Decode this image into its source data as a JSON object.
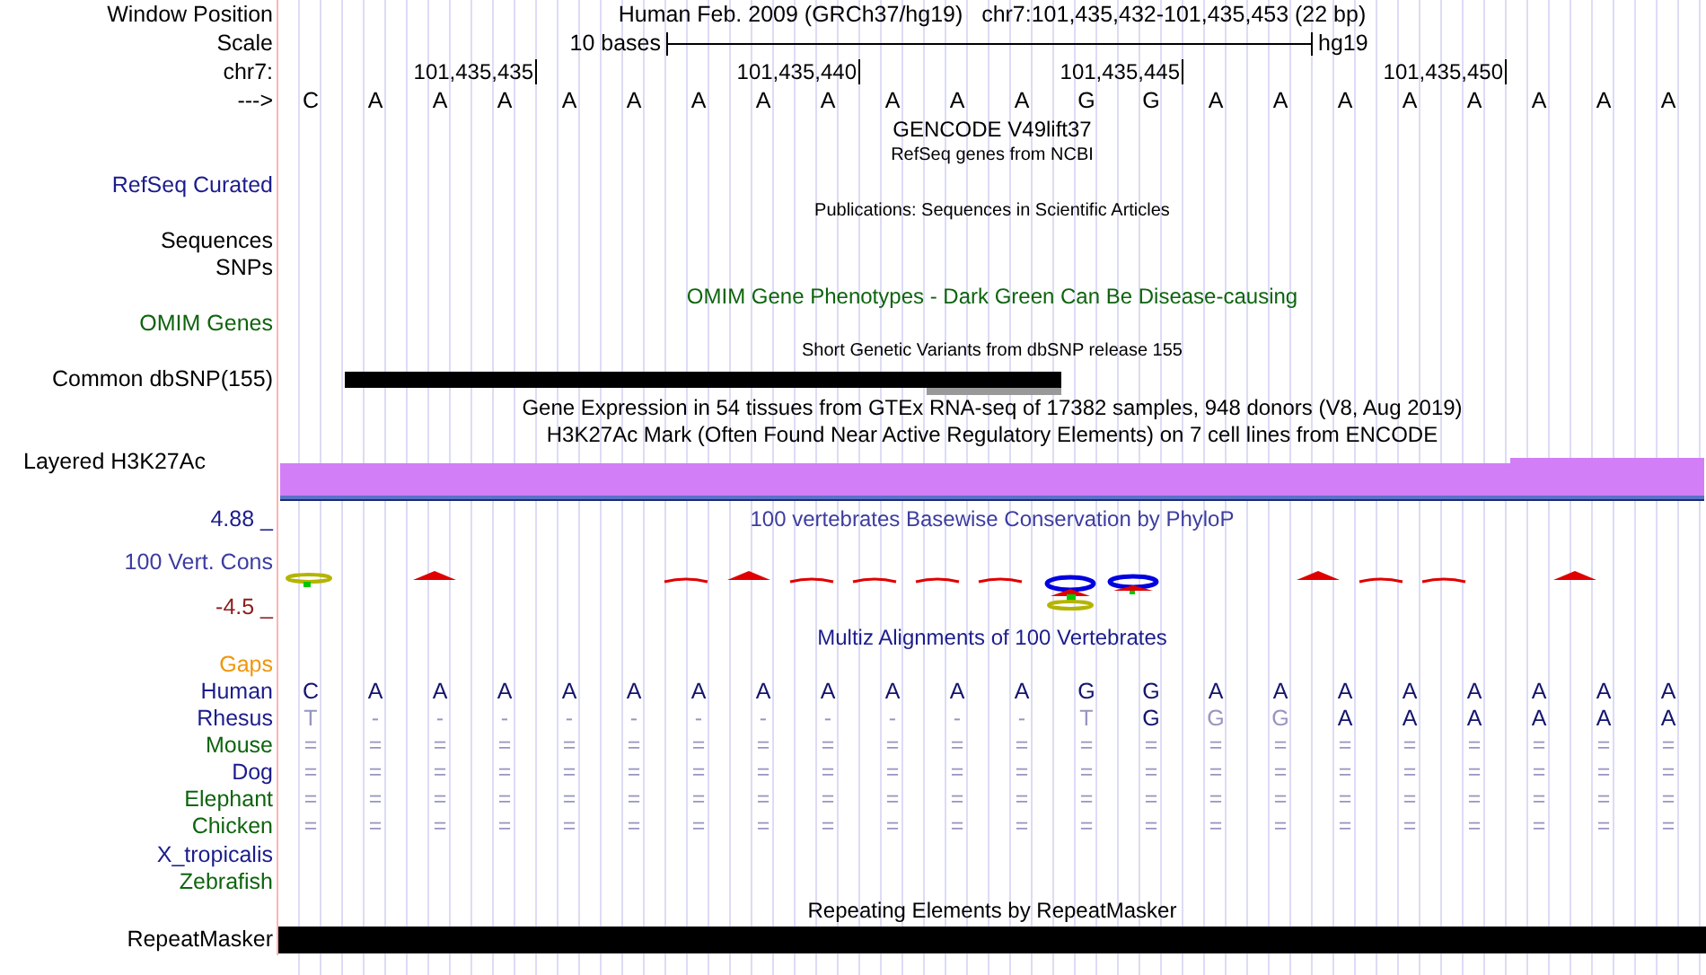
{
  "header": {
    "label": "Window Position",
    "title": "Human Feb. 2009 (GRCh37/hg19)   chr7:101,435,432-101,435,453 (22 bp)"
  },
  "scale": {
    "label": "Scale",
    "text": "10 bases",
    "assembly": "hg19"
  },
  "ruler": {
    "label": "chr7:",
    "ticks": [
      "101,435,435",
      "101,435,440",
      "101,435,445",
      "101,435,450"
    ]
  },
  "sequence": {
    "label": "--->",
    "bases": [
      "C",
      "A",
      "A",
      "A",
      "A",
      "A",
      "A",
      "A",
      "A",
      "A",
      "A",
      "A",
      "G",
      "G",
      "A",
      "A",
      "A",
      "A",
      "A",
      "A",
      "A",
      "A"
    ]
  },
  "tracks": [
    {
      "kind": "title",
      "title": "GENCODE V49lift37"
    },
    {
      "kind": "subtitle",
      "title": "RefSeq genes from NCBI"
    },
    {
      "kind": "label",
      "label": "RefSeq Curated",
      "color": "#1c1c8c"
    },
    {
      "kind": "subtitle",
      "title": "Publications: Sequences in Scientific Articles"
    },
    {
      "kind": "label",
      "label": "Sequences",
      "color": "#000000"
    },
    {
      "kind": "label",
      "label": "SNPs",
      "color": "#000000"
    },
    {
      "kind": "title",
      "title": "OMIM Gene Phenotypes - Dark Green Can Be Disease-causing",
      "color": "#0e640e"
    },
    {
      "kind": "label",
      "label": "OMIM Genes",
      "color": "#0e640e"
    },
    {
      "kind": "subtitle",
      "title": "Short Genetic Variants from dbSNP release 155"
    },
    {
      "kind": "variants",
      "label": "Common dbSNP(155)"
    },
    {
      "kind": "title",
      "title": "Gene Expression in 54 tissues from GTEx RNA-seq of 17382 samples, 948 donors (V8, Aug 2019)"
    },
    {
      "kind": "title",
      "title": "H3K27Ac Mark (Often Found Near Active Regulatory Elements) on 7 cell lines from ENCODE"
    },
    {
      "kind": "signal",
      "label": "Layered H3K27Ac"
    },
    {
      "kind": "conservation",
      "title": "100 vertebrates Basewise Conservation by PhyloP",
      "label": "100 Vert. Cons",
      "max": "4.88 _",
      "min": "-4.5 _"
    },
    {
      "kind": "title",
      "title": "Multiz Alignments of 100 Vertebrates",
      "color": "#1c1c8c"
    },
    {
      "kind": "label",
      "label": "Gaps",
      "color": "#f0960a"
    },
    {
      "kind": "alignment",
      "label": "Human",
      "color": "#1c1c8c",
      "cells": [
        {
          "base": "C",
          "match": true
        },
        {
          "base": "A",
          "match": true
        },
        {
          "base": "A",
          "match": true
        },
        {
          "base": "A",
          "match": true
        },
        {
          "base": "A",
          "match": true
        },
        {
          "base": "A",
          "match": true
        },
        {
          "base": "A",
          "match": true
        },
        {
          "base": "A",
          "match": true
        },
        {
          "base": "A",
          "match": true
        },
        {
          "base": "A",
          "match": true
        },
        {
          "base": "A",
          "match": true
        },
        {
          "base": "A",
          "match": true
        },
        {
          "base": "G",
          "match": true
        },
        {
          "base": "G",
          "match": true
        },
        {
          "base": "A",
          "match": true
        },
        {
          "base": "A",
          "match": true
        },
        {
          "base": "A",
          "match": true
        },
        {
          "base": "A",
          "match": true
        },
        {
          "base": "A",
          "match": true
        },
        {
          "base": "A",
          "match": true
        },
        {
          "base": "A",
          "match": true
        },
        {
          "base": "A",
          "match": true
        }
      ]
    },
    {
      "kind": "alignment",
      "label": "Rhesus",
      "color": "#1c1c8c",
      "cells": [
        {
          "base": "T",
          "match": false
        },
        {
          "base": "-",
          "match": false
        },
        {
          "base": "-",
          "match": false
        },
        {
          "base": "-",
          "match": false
        },
        {
          "base": "-",
          "match": false
        },
        {
          "base": "-",
          "match": false
        },
        {
          "base": "-",
          "match": false
        },
        {
          "base": "-",
          "match": false
        },
        {
          "base": "-",
          "match": false
        },
        {
          "base": "-",
          "match": false
        },
        {
          "base": "-",
          "match": false
        },
        {
          "base": "-",
          "match": false
        },
        {
          "base": "T",
          "match": false
        },
        {
          "base": "G",
          "match": true
        },
        {
          "base": "G",
          "match": false
        },
        {
          "base": "G",
          "match": false
        },
        {
          "base": "A",
          "match": true
        },
        {
          "base": "A",
          "match": true
        },
        {
          "base": "A",
          "match": true
        },
        {
          "base": "A",
          "match": true
        },
        {
          "base": "A",
          "match": true
        },
        {
          "base": "A",
          "match": true
        }
      ]
    },
    {
      "kind": "alignment",
      "label": "Mouse",
      "color": "#0e640e",
      "cells": [
        {
          "base": "=",
          "match": false
        },
        {
          "base": "=",
          "match": false
        },
        {
          "base": "=",
          "match": false
        },
        {
          "base": "=",
          "match": false
        },
        {
          "base": "=",
          "match": false
        },
        {
          "base": "=",
          "match": false
        },
        {
          "base": "=",
          "match": false
        },
        {
          "base": "=",
          "match": false
        },
        {
          "base": "=",
          "match": false
        },
        {
          "base": "=",
          "match": false
        },
        {
          "base": "=",
          "match": false
        },
        {
          "base": "=",
          "match": false
        },
        {
          "base": "=",
          "match": false
        },
        {
          "base": "=",
          "match": false
        },
        {
          "base": "=",
          "match": false
        },
        {
          "base": "=",
          "match": false
        },
        {
          "base": "=",
          "match": false
        },
        {
          "base": "=",
          "match": false
        },
        {
          "base": "=",
          "match": false
        },
        {
          "base": "=",
          "match": false
        },
        {
          "base": "=",
          "match": false
        },
        {
          "base": "=",
          "match": false
        }
      ]
    },
    {
      "kind": "alignment",
      "label": "Dog",
      "color": "#1c1c8c",
      "cells": [
        {
          "base": "=",
          "match": false
        },
        {
          "base": "=",
          "match": false
        },
        {
          "base": "=",
          "match": false
        },
        {
          "base": "=",
          "match": false
        },
        {
          "base": "=",
          "match": false
        },
        {
          "base": "=",
          "match": false
        },
        {
          "base": "=",
          "match": false
        },
        {
          "base": "=",
          "match": false
        },
        {
          "base": "=",
          "match": false
        },
        {
          "base": "=",
          "match": false
        },
        {
          "base": "=",
          "match": false
        },
        {
          "base": "=",
          "match": false
        },
        {
          "base": "=",
          "match": false
        },
        {
          "base": "=",
          "match": false
        },
        {
          "base": "=",
          "match": false
        },
        {
          "base": "=",
          "match": false
        },
        {
          "base": "=",
          "match": false
        },
        {
          "base": "=",
          "match": false
        },
        {
          "base": "=",
          "match": false
        },
        {
          "base": "=",
          "match": false
        },
        {
          "base": "=",
          "match": false
        },
        {
          "base": "=",
          "match": false
        }
      ]
    },
    {
      "kind": "alignment",
      "label": "Elephant",
      "color": "#0e640e",
      "cells": [
        {
          "base": "=",
          "match": false
        },
        {
          "base": "=",
          "match": false
        },
        {
          "base": "=",
          "match": false
        },
        {
          "base": "=",
          "match": false
        },
        {
          "base": "=",
          "match": false
        },
        {
          "base": "=",
          "match": false
        },
        {
          "base": "=",
          "match": false
        },
        {
          "base": "=",
          "match": false
        },
        {
          "base": "=",
          "match": false
        },
        {
          "base": "=",
          "match": false
        },
        {
          "base": "=",
          "match": false
        },
        {
          "base": "=",
          "match": false
        },
        {
          "base": "=",
          "match": false
        },
        {
          "base": "=",
          "match": false
        },
        {
          "base": "=",
          "match": false
        },
        {
          "base": "=",
          "match": false
        },
        {
          "base": "=",
          "match": false
        },
        {
          "base": "=",
          "match": false
        },
        {
          "base": "=",
          "match": false
        },
        {
          "base": "=",
          "match": false
        },
        {
          "base": "=",
          "match": false
        },
        {
          "base": "=",
          "match": false
        }
      ]
    },
    {
      "kind": "alignment",
      "label": "Chicken",
      "color": "#0e640e",
      "cells": [
        {
          "base": "=",
          "match": false
        },
        {
          "base": "=",
          "match": false
        },
        {
          "base": "=",
          "match": false
        },
        {
          "base": "=",
          "match": false
        },
        {
          "base": "=",
          "match": false
        },
        {
          "base": "=",
          "match": false
        },
        {
          "base": "=",
          "match": false
        },
        {
          "base": "=",
          "match": false
        },
        {
          "base": "=",
          "match": false
        },
        {
          "base": "=",
          "match": false
        },
        {
          "base": "=",
          "match": false
        },
        {
          "base": "=",
          "match": false
        },
        {
          "base": "=",
          "match": false
        },
        {
          "base": "=",
          "match": false
        },
        {
          "base": "=",
          "match": false
        },
        {
          "base": "=",
          "match": false
        },
        {
          "base": "=",
          "match": false
        },
        {
          "base": "=",
          "match": false
        },
        {
          "base": "=",
          "match": false
        },
        {
          "base": "=",
          "match": false
        },
        {
          "base": "=",
          "match": false
        },
        {
          "base": "=",
          "match": false
        }
      ]
    },
    {
      "kind": "label",
      "label": "X_tropicalis",
      "color": "#1c1c8c"
    },
    {
      "kind": "label",
      "label": "Zebrafish",
      "color": "#0e640e"
    },
    {
      "kind": "title",
      "title": "Repeating Elements by RepeatMasker"
    },
    {
      "kind": "repeats",
      "label": "RepeatMasker"
    }
  ]
}
